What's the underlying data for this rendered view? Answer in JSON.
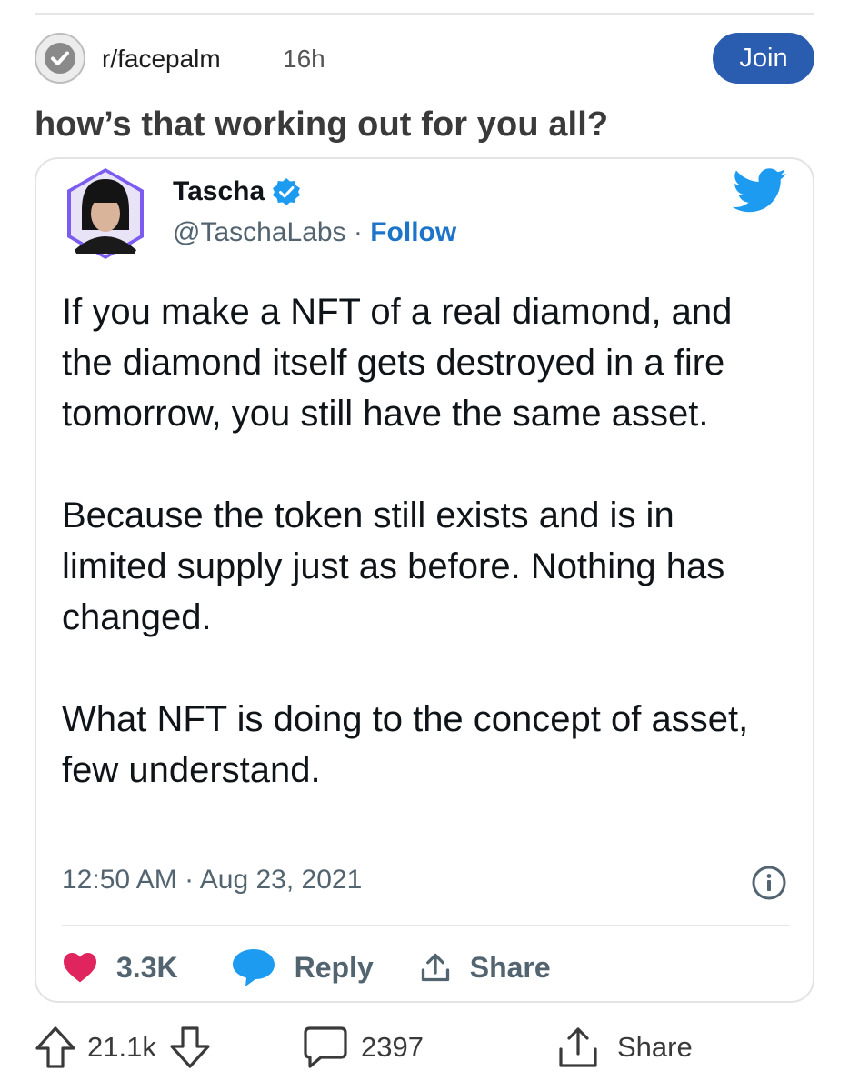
{
  "post": {
    "subreddit": "r/facepalm",
    "age": "16h",
    "join_label": "Join",
    "title": "how’s that working out for you all?",
    "votes": "21.1k",
    "comments": "2397",
    "share_label": "Share",
    "subreddit_icon": "verified-check-icon"
  },
  "tweet": {
    "name": "Tascha",
    "handle": "@TaschaLabs",
    "separator": " · ",
    "follow_label": "Follow",
    "paragraphs": [
      "If you make a NFT of a real diamond, and the diamond itself gets destroyed in a fire tomorrow, you still have the same asset.",
      "Because the token still exists and is in limited supply just as before. Nothing has changed.",
      "What NFT is doing to the concept of asset, few understand."
    ],
    "timestamp": "12:50 AM · Aug 23, 2021",
    "likes": "3.3K",
    "reply_label": "Reply",
    "share_label": "Share"
  },
  "colors": {
    "join_button": "#2a5db0",
    "twitter_blue": "#1d9bf0",
    "like_pink": "#e0245e",
    "follow_link": "#1d74c9"
  }
}
